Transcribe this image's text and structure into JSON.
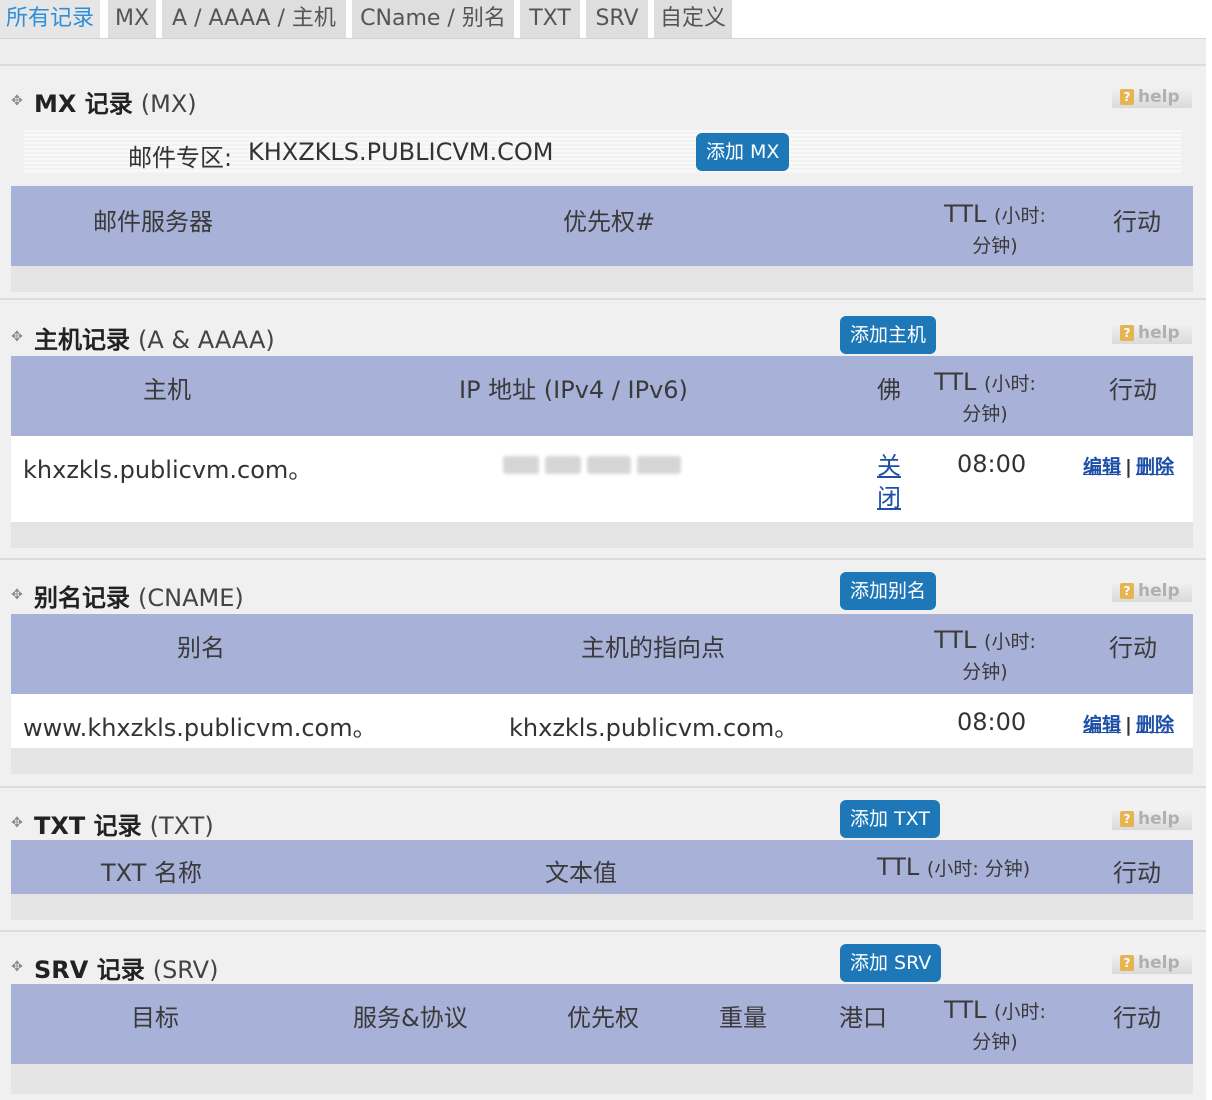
{
  "tabs": [
    "所有记录",
    "MX",
    "A / AAAA / 主机",
    "CName / 别名",
    "TXT",
    "SRV",
    "自定义"
  ],
  "help_label": "help",
  "mx": {
    "title": "MX 记录",
    "subtitle": "(MX)",
    "zone_label": "邮件专区:",
    "zone_value": "KHXZKLS.PUBLICVM.COM",
    "add_button": "添加 MX",
    "headers": {
      "server": "邮件服务器",
      "priority": "优先权#",
      "ttl_main": "TTL",
      "ttl_sub1": "(小时:",
      "ttl_sub2": "分钟)",
      "action": "行动"
    }
  },
  "host": {
    "title": "主机记录",
    "subtitle": "(A & AAAA)",
    "add_button": "添加主机",
    "headers": {
      "host": "主机",
      "ip": "IP 地址  (IPv4 / IPv6)",
      "fo": "佛",
      "ttl_main": "TTL",
      "ttl_sub1": "(小时:",
      "ttl_sub2": "分钟)",
      "action": "行动"
    },
    "rows": [
      {
        "host": "khxzkls.publicvm.com。",
        "fo_line1": "关",
        "fo_line2": "闭",
        "ttl": "08:00",
        "edit": "编辑",
        "sep": "|",
        "delete": "删除"
      }
    ]
  },
  "cname": {
    "title": "别名记录",
    "subtitle": "(CNAME)",
    "add_button": "添加别名",
    "headers": {
      "alias": "别名",
      "target": "主机的指向点",
      "ttl_main": "TTL",
      "ttl_sub1": "(小时:",
      "ttl_sub2": "分钟)",
      "action": "行动"
    },
    "rows": [
      {
        "alias": "www.khxzkls.publicvm.com。",
        "target": "khxzkls.publicvm.com。",
        "ttl": "08:00",
        "edit": "编辑",
        "sep": "|",
        "delete": "删除"
      }
    ]
  },
  "txt": {
    "title": "TXT 记录",
    "subtitle": "(TXT)",
    "add_button": "添加 TXT",
    "headers": {
      "name": "TXT 名称",
      "value": "文本值",
      "ttl_main": "TTL",
      "ttl_sub": "(小时: 分钟)",
      "action": "行动"
    }
  },
  "srv": {
    "title": "SRV 记录",
    "subtitle": "(SRV)",
    "add_button": "添加 SRV",
    "headers": {
      "target": "目标",
      "service": "服务&协议",
      "priority": "优先权",
      "weight": "重量",
      "port": "港口",
      "ttl_main": "TTL",
      "ttl_sub1": "(小时:",
      "ttl_sub2": "分钟)",
      "action": "行动"
    }
  }
}
